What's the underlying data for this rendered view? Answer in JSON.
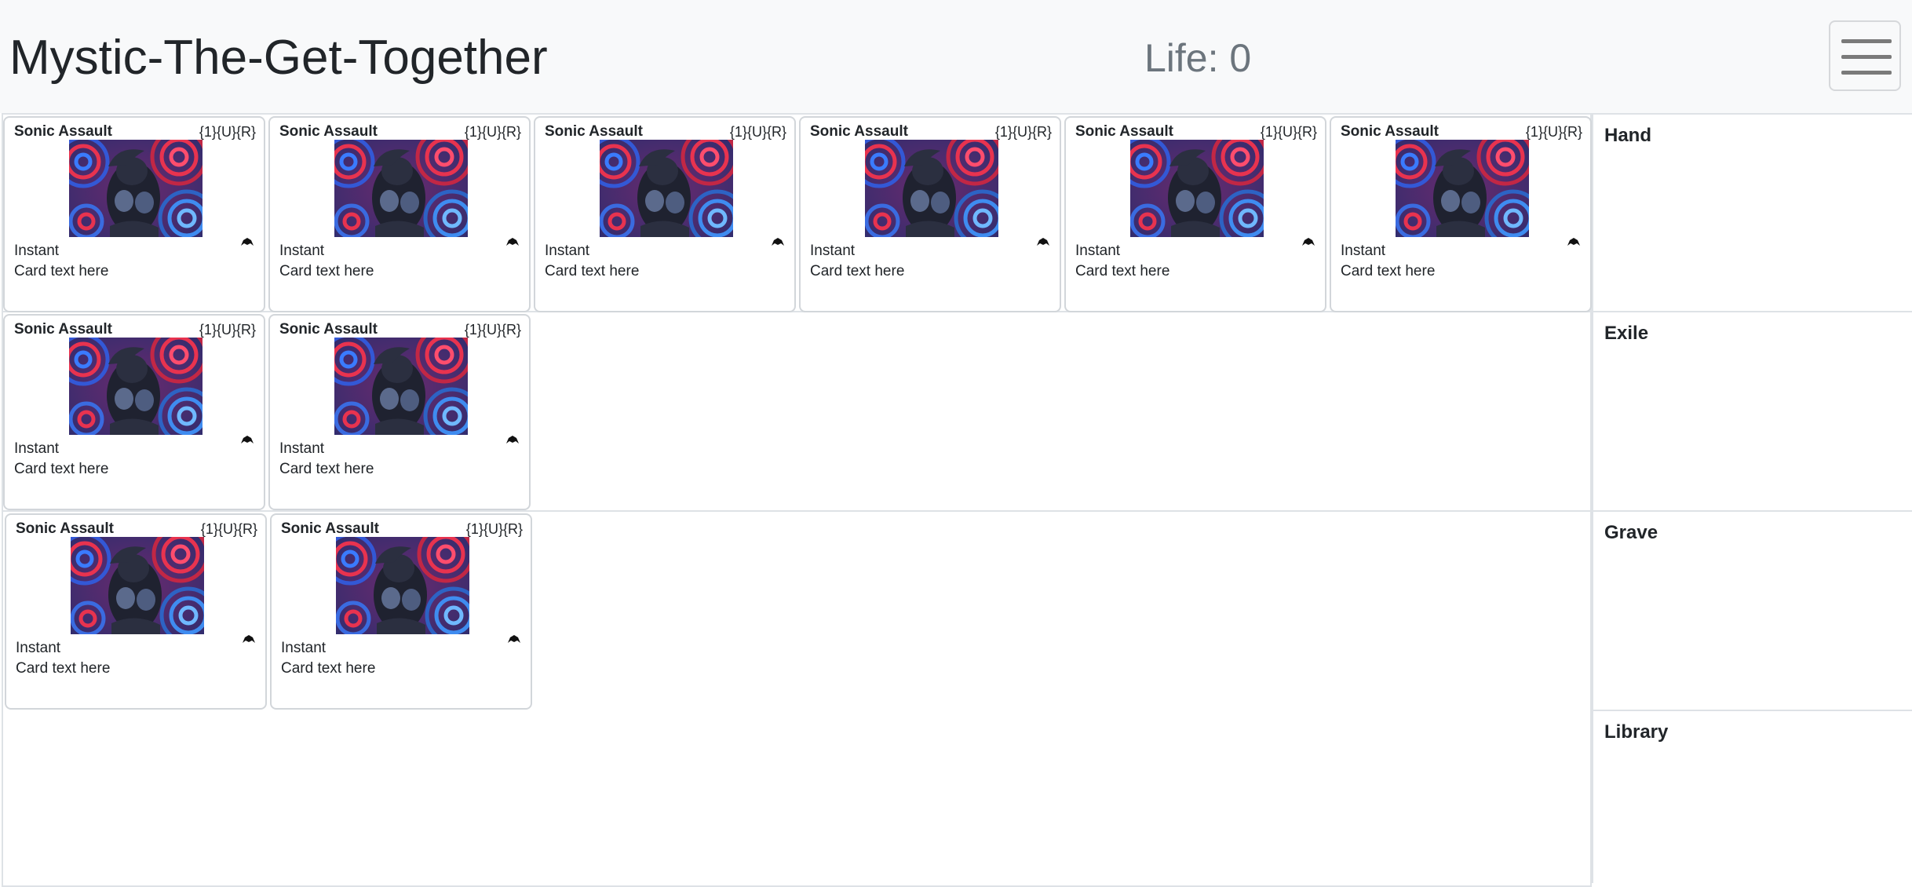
{
  "header": {
    "title": "Mystic-The-Get-Together",
    "life": "Life: 0",
    "menu_icon": "hamburger-menu-icon"
  },
  "battlefield": {
    "rows": [
      {
        "cards": [
          {
            "name": "Sonic Assault",
            "cost": "{1}{U}{R}",
            "type": "Instant",
            "text": "Card text here"
          },
          {
            "name": "Sonic Assault",
            "cost": "{1}{U}{R}",
            "type": "Instant",
            "text": "Card text here"
          },
          {
            "name": "Sonic Assault",
            "cost": "{1}{U}{R}",
            "type": "Instant",
            "text": "Card text here"
          },
          {
            "name": "Sonic Assault",
            "cost": "{1}{U}{R}",
            "type": "Instant",
            "text": "Card text here"
          },
          {
            "name": "Sonic Assault",
            "cost": "{1}{U}{R}",
            "type": "Instant",
            "text": "Card text here"
          },
          {
            "name": "Sonic Assault",
            "cost": "{1}{U}{R}",
            "type": "Instant",
            "text": "Card text here"
          }
        ]
      },
      {
        "cards": [
          {
            "name": "Sonic Assault",
            "cost": "{1}{U}{R}",
            "type": "Instant",
            "text": "Card text here"
          },
          {
            "name": "Sonic Assault",
            "cost": "{1}{U}{R}",
            "type": "Instant",
            "text": "Card text here"
          }
        ]
      },
      {
        "cards": [
          {
            "name": "Sonic Assault",
            "cost": "{1}{U}{R}",
            "type": "Instant",
            "text": "Card text here"
          },
          {
            "name": "Sonic Assault",
            "cost": "{1}{U}{R}",
            "type": "Instant",
            "text": "Card text here"
          }
        ]
      }
    ]
  },
  "zones": {
    "hand": "Hand",
    "exile": "Exile",
    "grave": "Grave",
    "library": "Library"
  },
  "colors": {
    "header_bg": "#f8f9fa",
    "life_text": "#6c757d",
    "border": "#dee2e6"
  }
}
